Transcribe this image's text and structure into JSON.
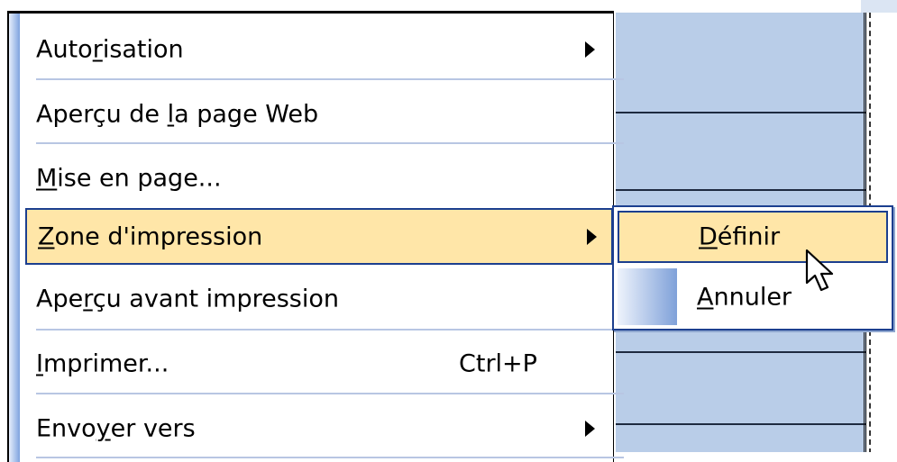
{
  "menu": {
    "items": [
      {
        "id": "autorisation",
        "before": "Auto",
        "u": "r",
        "after": "isation",
        "shortcut": "",
        "submenu": true
      },
      {
        "id": "apercu-page-web",
        "before": "Aperçu de ",
        "u": "l",
        "after": "a page Web",
        "shortcut": "",
        "submenu": false
      },
      {
        "id": "mise-en-page",
        "before": "",
        "u": "M",
        "after": "ise en page...",
        "shortcut": "",
        "submenu": false
      },
      {
        "id": "zone-impression",
        "before": "",
        "u": "Z",
        "after": "one d'impression",
        "shortcut": "",
        "submenu": true
      },
      {
        "id": "apercu-avant-impression",
        "before": "Ape",
        "u": "r",
        "after": "çu avant impression",
        "shortcut": "",
        "submenu": false
      },
      {
        "id": "imprimer",
        "before": "",
        "u": "I",
        "after": "mprimer...",
        "shortcut": "Ctrl+P",
        "submenu": false
      },
      {
        "id": "envoyer-vers",
        "before": "Envo",
        "u": "y",
        "after": "er vers",
        "shortcut": "",
        "submenu": true
      }
    ]
  },
  "submenu": {
    "items": [
      {
        "id": "definir",
        "before": "",
        "u": "D",
        "after": "éfinir"
      },
      {
        "id": "annuler",
        "before": "",
        "u": "A",
        "after": "nnuler"
      }
    ]
  },
  "colors": {
    "highlight_fill": "#ffe6a8",
    "highlight_border": "#1c3f8f",
    "sheet_blue": "#b9cde8"
  },
  "icons": {
    "submenu_arrow": "submenu-arrow-icon",
    "cursor": "mouse-pointer-icon"
  }
}
